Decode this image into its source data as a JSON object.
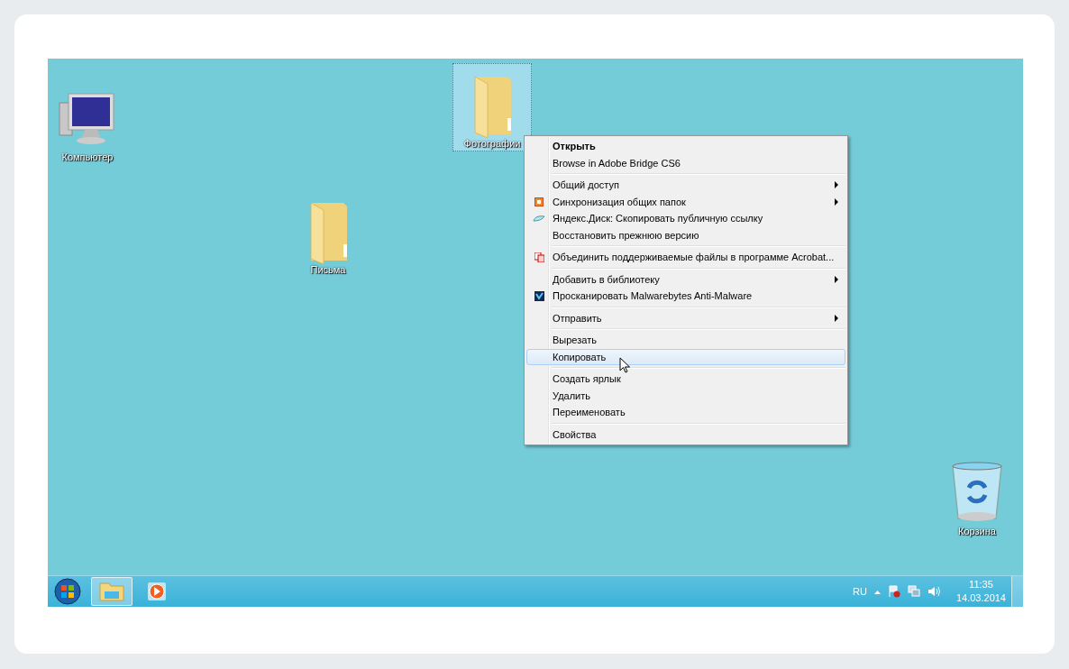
{
  "desktop_icons": [
    {
      "label": "Компьютер",
      "kind": "computer",
      "selected": false
    },
    {
      "label": "Фотографии",
      "kind": "folder",
      "selected": true
    },
    {
      "label": "Письма",
      "kind": "folder",
      "selected": false
    },
    {
      "label": "Корзина",
      "kind": "recycle-bin",
      "selected": false
    }
  ],
  "context_menu": {
    "groups": [
      [
        {
          "label": "Открыть",
          "kind": "plain",
          "default": true,
          "submenu": false,
          "selected": false
        },
        {
          "label": "Browse in Adobe Bridge CS6",
          "kind": "plain",
          "default": false,
          "submenu": false,
          "selected": false
        }
      ],
      [
        {
          "label": "Общий доступ",
          "kind": "plain",
          "default": false,
          "submenu": true,
          "selected": false
        },
        {
          "label": "Синхронизация общих папок",
          "kind": "sync",
          "default": false,
          "submenu": true,
          "selected": false
        },
        {
          "label": "Яндекс.Диск: Скопировать публичную ссылку",
          "kind": "cloud",
          "default": false,
          "submenu": false,
          "selected": false
        },
        {
          "label": "Восстановить прежнюю версию",
          "kind": "plain",
          "default": false,
          "submenu": false,
          "selected": false
        }
      ],
      [
        {
          "label": "Объединить поддерживаемые файлы в программе Acrobat...",
          "kind": "pdf",
          "default": false,
          "submenu": false,
          "selected": false
        }
      ],
      [
        {
          "label": "Добавить в библиотеку",
          "kind": "plain",
          "default": false,
          "submenu": true,
          "selected": false
        },
        {
          "label": "Просканировать Malwarebytes Anti-Malware",
          "kind": "scan",
          "default": false,
          "submenu": false,
          "selected": false
        }
      ],
      [
        {
          "label": "Отправить",
          "kind": "plain",
          "default": false,
          "submenu": true,
          "selected": false
        }
      ],
      [
        {
          "label": "Вырезать",
          "kind": "plain",
          "default": false,
          "submenu": false,
          "selected": false
        },
        {
          "label": "Копировать",
          "kind": "plain",
          "default": false,
          "submenu": false,
          "selected": true
        }
      ],
      [
        {
          "label": "Создать ярлык",
          "kind": "plain",
          "default": false,
          "submenu": false,
          "selected": false
        },
        {
          "label": "Удалить",
          "kind": "plain",
          "default": false,
          "submenu": false,
          "selected": false
        },
        {
          "label": "Переименовать",
          "kind": "plain",
          "default": false,
          "submenu": false,
          "selected": false
        }
      ],
      [
        {
          "label": "Свойства",
          "kind": "plain",
          "default": false,
          "submenu": false,
          "selected": false
        }
      ]
    ]
  },
  "taskbar": {
    "buttons": [
      {
        "kind": "explorer",
        "selected": true
      },
      {
        "kind": "media-player",
        "selected": false
      }
    ],
    "tray": {
      "language": "RU",
      "time": "11:35",
      "date": "14.03.2014"
    }
  }
}
